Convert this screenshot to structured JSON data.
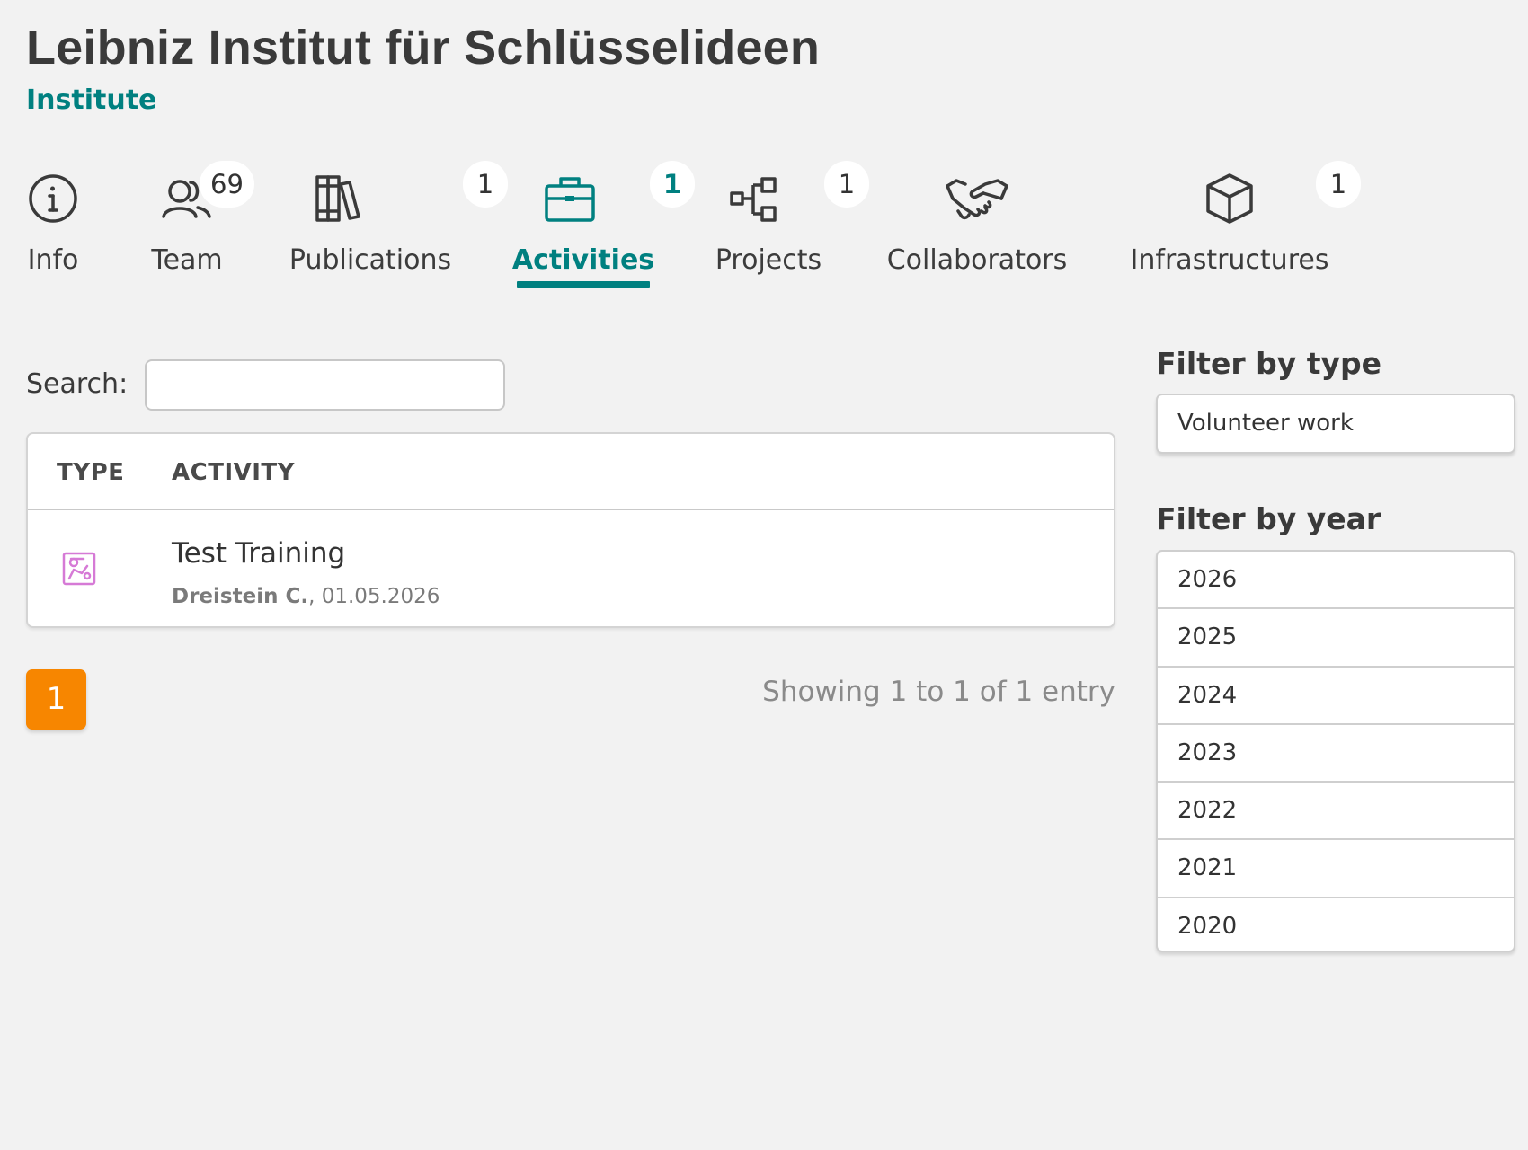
{
  "header": {
    "title": "Leibniz Institut für Schlüsselideen",
    "subtitle": "Institute"
  },
  "tabs": [
    {
      "label": "Info",
      "icon": "info-icon",
      "badge": null,
      "active": false
    },
    {
      "label": "Team",
      "icon": "users-icon",
      "badge": "69",
      "active": false
    },
    {
      "label": "Publications",
      "icon": "books-icon",
      "badge": "1",
      "active": false
    },
    {
      "label": "Activities",
      "icon": "briefcase-icon",
      "badge": "1",
      "active": true
    },
    {
      "label": "Projects",
      "icon": "tree-structure-icon",
      "badge": "1",
      "active": false
    },
    {
      "label": "Collaborators",
      "icon": "handshake-icon",
      "badge": null,
      "active": false
    },
    {
      "label": "Infrastructures",
      "icon": "cube-icon",
      "badge": "1",
      "active": false
    }
  ],
  "search": {
    "label": "Search:",
    "value": "",
    "placeholder": ""
  },
  "table": {
    "columns": [
      "TYPE",
      "ACTIVITY"
    ],
    "rows": [
      {
        "type_icon": "chalkboard-teacher-icon",
        "title": "Test Training",
        "author": "Dreistein C.",
        "date": ", 01.05.2026"
      }
    ]
  },
  "pagination": {
    "current_page": "1",
    "info": "Showing 1 to 1 of 1 entry"
  },
  "filters": {
    "type_heading": "Filter by type",
    "type_options": [
      "Volunteer work"
    ],
    "year_heading": "Filter by year",
    "years": [
      "2026",
      "2025",
      "2024",
      "2023",
      "2022",
      "2021",
      "2020"
    ]
  },
  "colors": {
    "accent": "#008080",
    "page_button": "#f78600",
    "activity_icon": "#d67ad6",
    "background": "#f2f2f2"
  }
}
